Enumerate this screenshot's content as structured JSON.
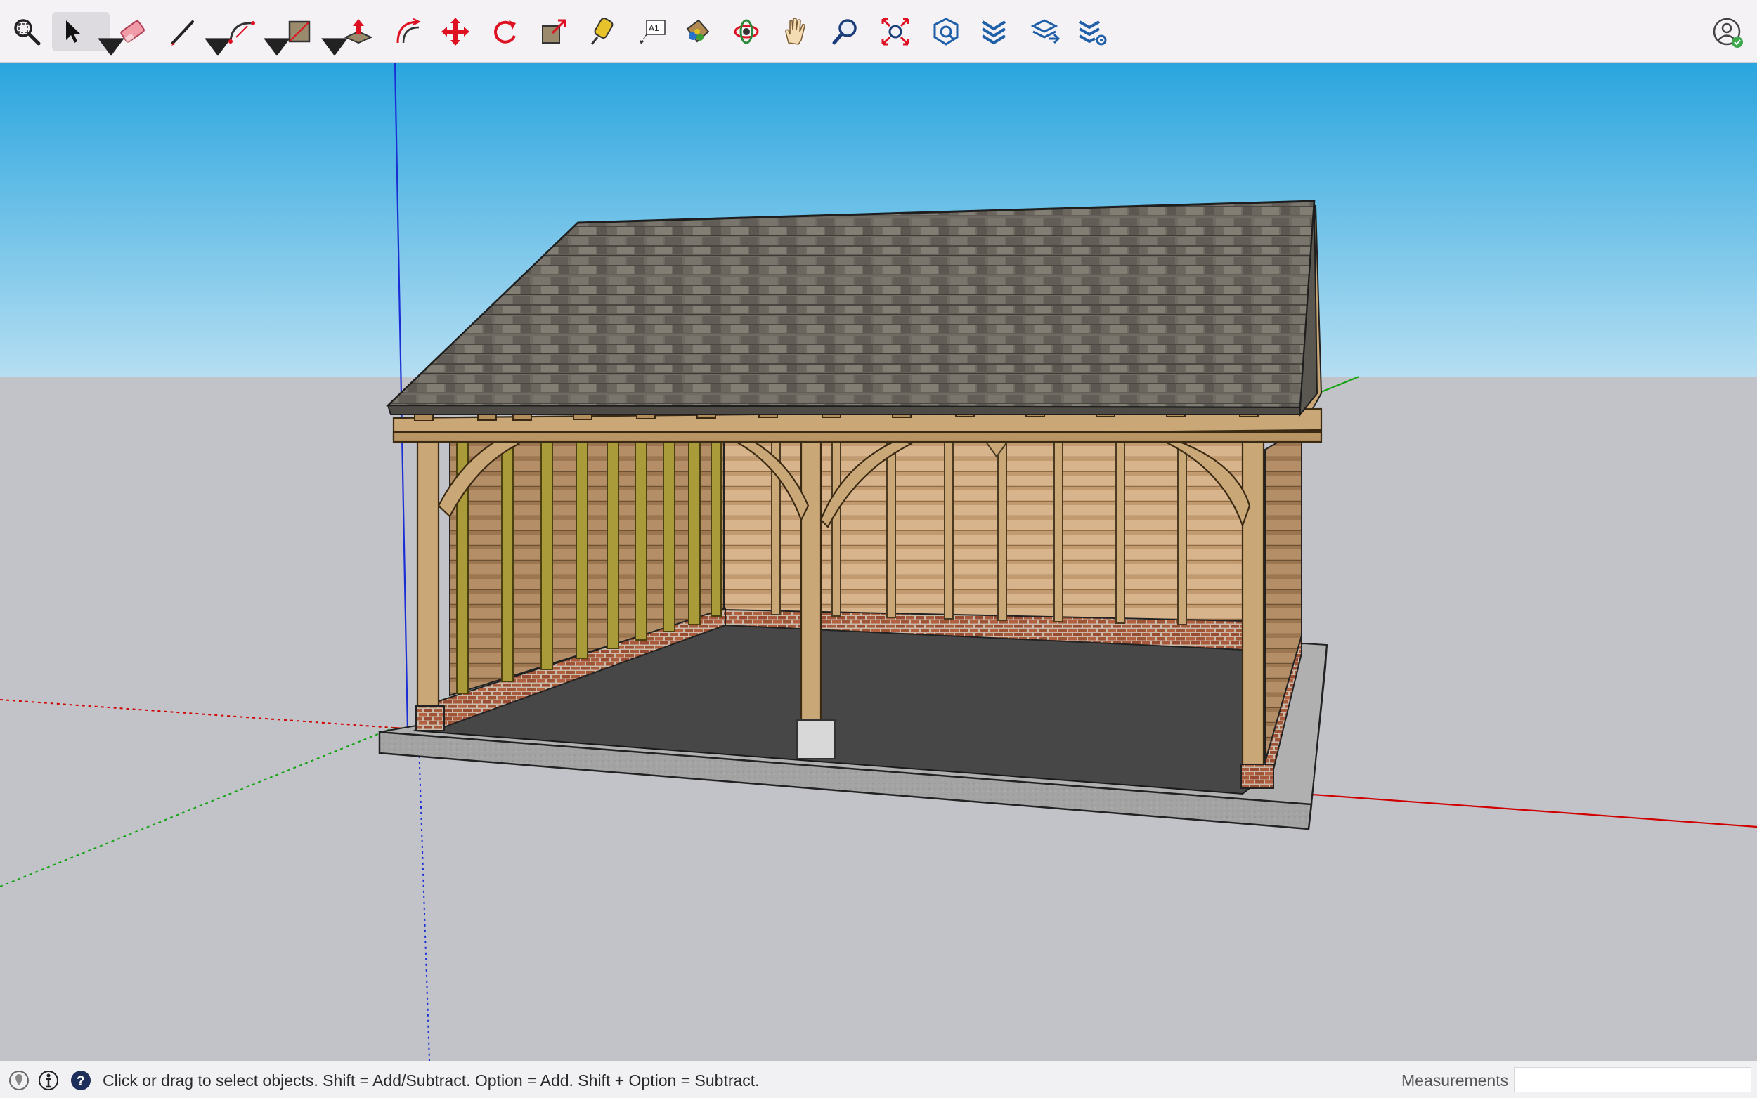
{
  "toolbar": {
    "tools": [
      {
        "id": "zoom-window",
        "icon": "magnifier-zoom-window-icon"
      },
      {
        "id": "select",
        "icon": "arrow-select-icon",
        "active": true,
        "has_menu": true
      },
      {
        "id": "eraser",
        "icon": "eraser-icon"
      },
      {
        "id": "line",
        "icon": "pencil-line-icon",
        "has_menu": true
      },
      {
        "id": "arc",
        "icon": "arc-icon",
        "has_menu": true
      },
      {
        "id": "rectangle",
        "icon": "rectangle-icon",
        "has_menu": true
      },
      {
        "id": "push-pull",
        "icon": "push-pull-icon"
      },
      {
        "id": "offset",
        "icon": "offset-icon"
      },
      {
        "id": "move",
        "icon": "move-arrows-icon"
      },
      {
        "id": "rotate",
        "icon": "rotate-icon"
      },
      {
        "id": "scale",
        "icon": "scale-icon"
      },
      {
        "id": "tape-measure",
        "icon": "tape-measure-icon"
      },
      {
        "id": "text",
        "icon": "text-label-icon",
        "label": "A1"
      },
      {
        "id": "paint-bucket",
        "icon": "paint-bucket-icon"
      },
      {
        "id": "orbit",
        "icon": "orbit-icon"
      },
      {
        "id": "pan",
        "icon": "hand-pan-icon"
      },
      {
        "id": "zoom",
        "icon": "magnifier-zoom-icon"
      },
      {
        "id": "zoom-extents",
        "icon": "zoom-extents-icon"
      },
      {
        "id": "3d-warehouse",
        "icon": "warehouse-icon"
      },
      {
        "id": "extension-warehouse",
        "icon": "extension-warehouse-icon"
      },
      {
        "id": "send-to-layout",
        "icon": "send-to-layout-icon"
      },
      {
        "id": "extension-manager",
        "icon": "extension-manager-icon"
      }
    ],
    "profile_icon": "user-profile-icon"
  },
  "status": {
    "hint": "Click or drag to select objects. Shift = Add/Subtract. Option = Add. Shift + Option = Subtract.",
    "icons": [
      "geo-location-icon",
      "credits-info-icon",
      "help-icon"
    ]
  },
  "measurements": {
    "label": "Measurements",
    "value": ""
  },
  "colors": {
    "sky_top": "#29a5de",
    "sky_bottom": "#b6def2",
    "ground": "#c2c3c8",
    "axis_red": "#d10000",
    "axis_green": "#11a311",
    "axis_blue": "#1a2ed6",
    "oak": "#c9a776",
    "roof": "#6f6a62",
    "brick": "#a85a3c",
    "floor": "#484848",
    "slab": "#a3a3a3"
  }
}
